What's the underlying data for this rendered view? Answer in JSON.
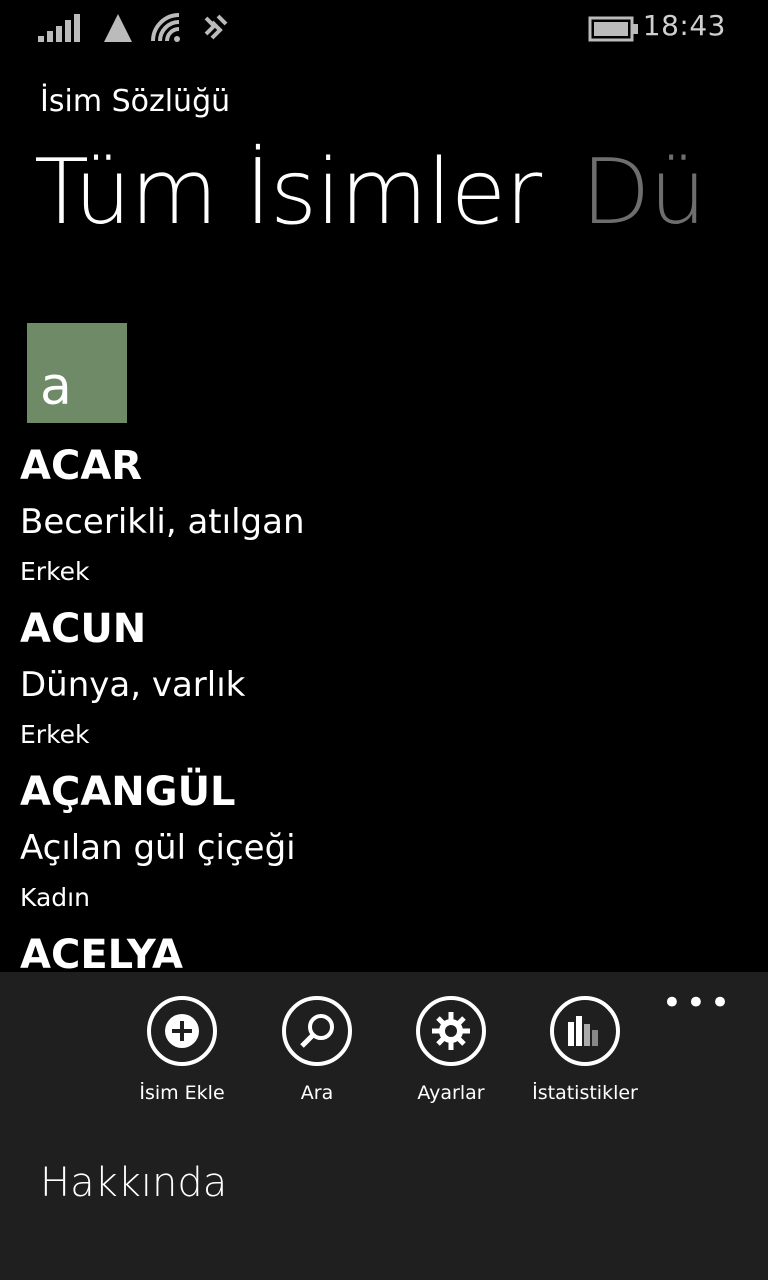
{
  "status_bar": {
    "time": "18:43",
    "icons": [
      "signal-icon",
      "data-icon",
      "wifi-icon",
      "nfc-icon",
      "battery-icon"
    ]
  },
  "app": {
    "title": "İsim Sözlüğü"
  },
  "pivot": {
    "active_header": "Tüm İsimler",
    "next_header": "Dü"
  },
  "group": {
    "letter": "a",
    "tile_color": "#6f8a67"
  },
  "names": [
    {
      "name": "ACAR",
      "meaning": "Becerikli, atılgan",
      "gender": "Erkek"
    },
    {
      "name": "ACUN",
      "meaning": "Dünya, varlık",
      "gender": "Erkek"
    },
    {
      "name": "AÇANGÜL",
      "meaning": "Açılan gül çiçeği",
      "gender": "Kadın"
    },
    {
      "name": "ACELYA",
      "meaning": "",
      "gender": ""
    }
  ],
  "app_bar": {
    "more": "•••",
    "buttons": [
      {
        "label": "İsim Ekle",
        "icon": "add-icon"
      },
      {
        "label": "Ara",
        "icon": "search-icon"
      },
      {
        "label": "Ayarlar",
        "icon": "settings-icon"
      },
      {
        "label": "İstatistikler",
        "icon": "stats-icon"
      }
    ],
    "menu_items": [
      "Hakkında"
    ]
  }
}
